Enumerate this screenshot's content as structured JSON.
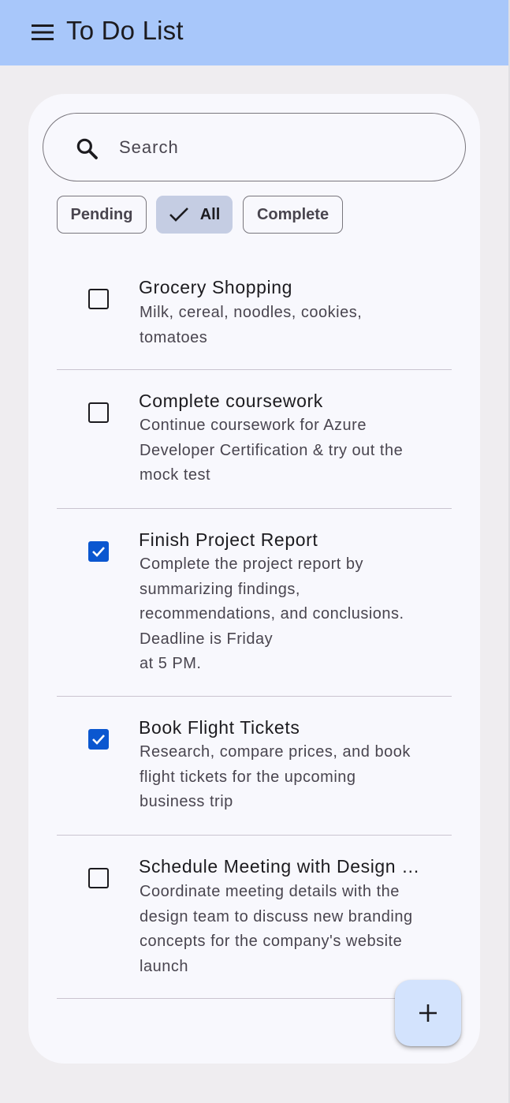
{
  "app_bar": {
    "title": "To Do List",
    "icon": "menu-icon",
    "background": "#a8c7fa"
  },
  "search": {
    "placeholder": "Search",
    "value": "",
    "icon": "search-icon"
  },
  "filters": [
    {
      "label": "Pending",
      "selected": false
    },
    {
      "label": "All",
      "selected": true,
      "icon": "check-icon"
    },
    {
      "label": "Complete",
      "selected": false
    }
  ],
  "tasks": [
    {
      "title": "Grocery Shopping",
      "description": "Milk, cereal, noodles, cookies,\ntomatoes",
      "completed": false
    },
    {
      "title": "Complete coursework",
      "description": "Continue coursework for Azure\nDeveloper Certification & try out the\nmock test",
      "completed": false
    },
    {
      "title": "Finish Project Report",
      "description": "Complete the project report by\nsummarizing findings,\nrecommendations, and conclusions.\nDeadline is Friday\nat 5 PM.",
      "completed": true
    },
    {
      "title": "Book Flight Tickets",
      "description": "Research, compare prices, and book\nflight tickets for the upcoming\nbusiness trip",
      "completed": true
    },
    {
      "title": "Schedule Meeting with Design …",
      "description": "Coordinate meeting details with the\ndesign team to discuss new branding\nconcepts for the company's website\nlaunch",
      "completed": false
    }
  ],
  "fab": {
    "icon": "plus-icon"
  },
  "colors": {
    "accent": "#0b57d0",
    "chip_selected": "#c5cde3",
    "fab": "#d3e3fd"
  }
}
